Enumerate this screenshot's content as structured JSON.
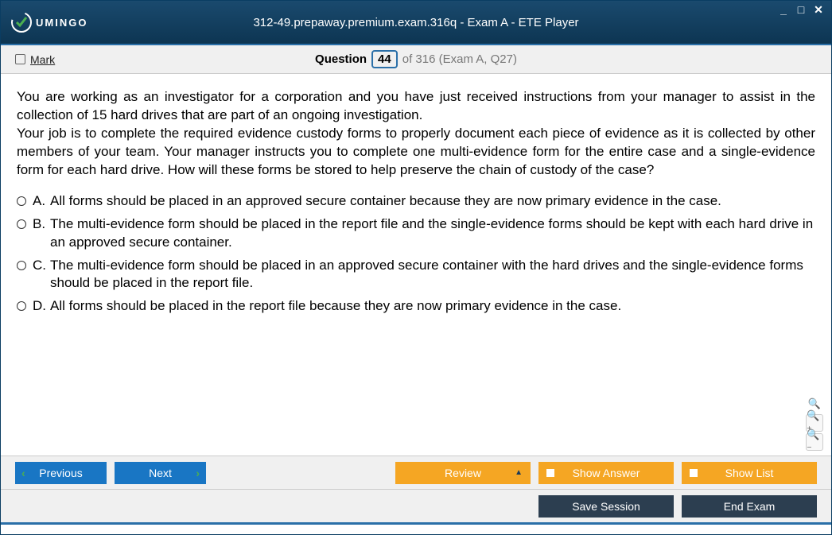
{
  "window": {
    "title": "312-49.prepaway.premium.exam.316q - Exam A - ETE Player",
    "logo_text": "UMINGO"
  },
  "header": {
    "mark_label": "Mark",
    "question_label": "Question",
    "question_number": "44",
    "question_total": "of 316 (Exam A, Q27)"
  },
  "question": {
    "text": "You are working as an investigator for a corporation and you have just received instructions from your manager to assist in the collection of 15 hard drives that are part of an ongoing investigation.\nYour job is to complete the required evidence custody forms to properly document each piece of evidence as it is collected by other members of your team. Your manager instructs you to complete one multi-evidence form for the entire case and a single-evidence form for each hard drive. How will these forms be stored to help preserve the chain of custody of the case?",
    "answers": [
      {
        "label": "A.",
        "text": "All forms should be placed in an approved secure container because they are now primary evidence in the case."
      },
      {
        "label": "B.",
        "text": "The multi-evidence form should be placed in the report file and the single-evidence forms should be kept with each hard drive in an approved secure container."
      },
      {
        "label": "C.",
        "text": "The multi-evidence form should be placed in an approved secure container with the hard drives and the single-evidence forms should be placed in the report file."
      },
      {
        "label": "D.",
        "text": "All forms should be placed in the report file because they are now primary evidence in the case."
      }
    ]
  },
  "nav": {
    "previous": "Previous",
    "next": "Next",
    "review": "Review",
    "show_answer": "Show Answer",
    "show_list": "Show List"
  },
  "bottom": {
    "save_session": "Save Session",
    "end_exam": "End Exam"
  }
}
